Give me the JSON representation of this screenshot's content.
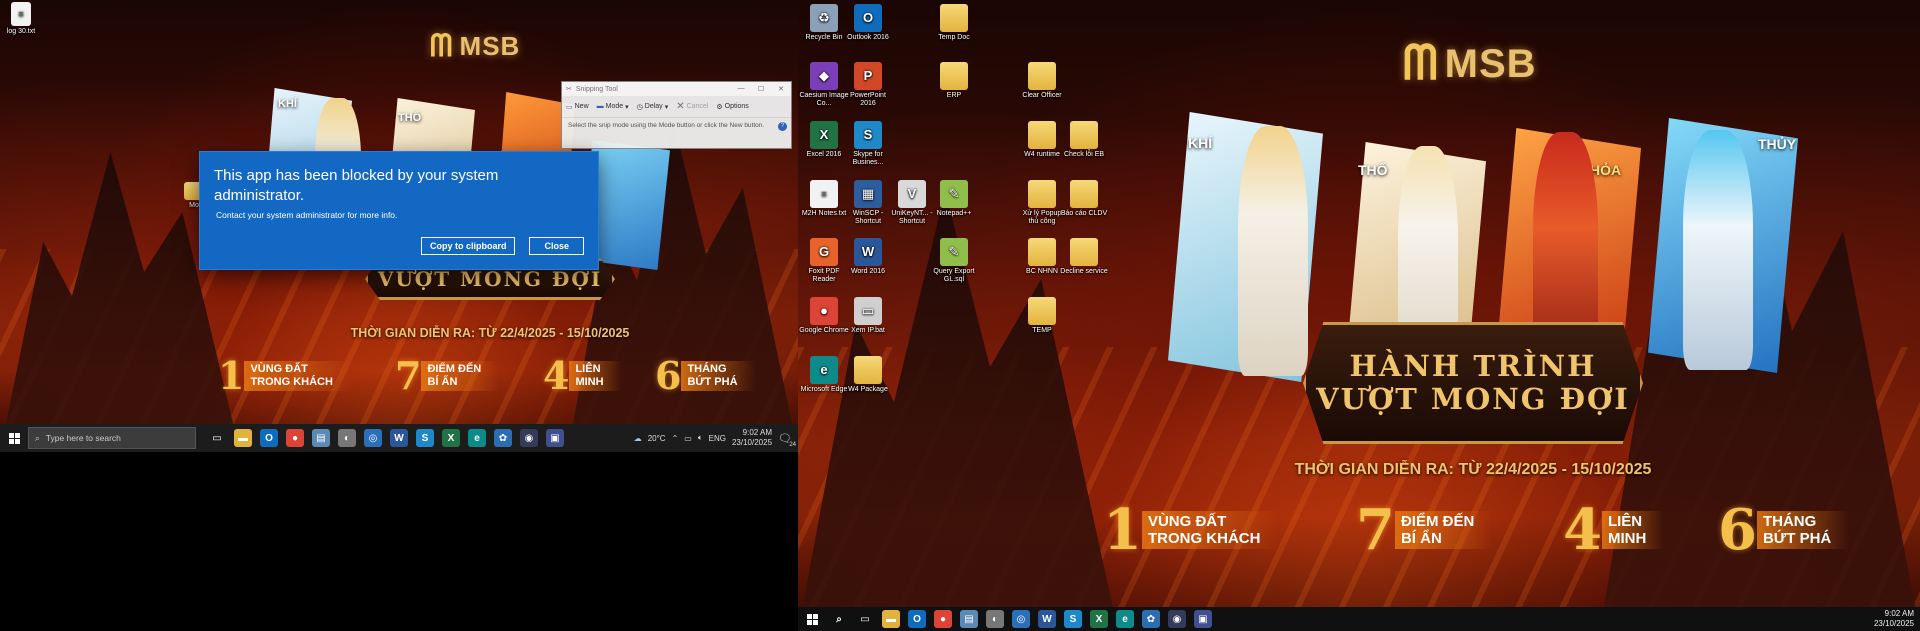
{
  "left_screen": {
    "desktop_file": {
      "label": "log 30.txt",
      "icon": "text-file-icon"
    },
    "partial_label": "Mo",
    "wallpaper": {
      "logo": "MSB",
      "cards": [
        "KHÍ",
        "THỔ"
      ],
      "banner_line2": "VƯỢT MONG ĐỢI",
      "subtitle": "THỜI GIAN DIỄN RA: TỪ 22/4/2025 - 15/10/2025",
      "features": [
        {
          "num": "1",
          "line1": "VÙNG ĐẤT",
          "line2": "TRONG KHÁCH"
        },
        {
          "num": "7",
          "line1": "ĐIỂM ĐẾN",
          "line2": "BÍ ẨN"
        },
        {
          "num": "4",
          "line1": "LIÊN",
          "line2": "MINH"
        },
        {
          "num": "6",
          "line1": "THÁNG",
          "line2": "BỨT PHÁ"
        }
      ]
    },
    "dialog": {
      "title": "This app has been blocked by your system administrator.",
      "message": "Contact your system administrator for more info.",
      "copy_label": "Copy to clipboard",
      "close_label": "Close"
    },
    "snipping_tool": {
      "title": "Snipping Tool",
      "new_label": "New",
      "mode_label": "Mode",
      "delay_label": "Delay",
      "cancel_label": "Cancel",
      "options_label": "Options",
      "hint": "Select the snip mode using the Mode button or click the New button."
    },
    "taskbar": {
      "search_placeholder": "Type here to search",
      "weather": "20°C",
      "lang": "ENG",
      "time": "9:02 AM",
      "date": "23/10/2025",
      "notification_count": "24",
      "apps": [
        {
          "name": "task-view-icon",
          "label": "▭",
          "color": "#1c1c1c"
        },
        {
          "name": "file-explorer-icon",
          "label": "▬",
          "color": "#e2b33c"
        },
        {
          "name": "outlook-icon",
          "label": "O",
          "color": "#0f6cbd"
        },
        {
          "name": "chrome-icon",
          "label": "●",
          "color": "#db4437"
        },
        {
          "name": "app-icon",
          "label": "▤",
          "color": "#5b8ab5"
        },
        {
          "name": "app-icon",
          "label": "◐",
          "color": "#777"
        },
        {
          "name": "app-icon",
          "label": "◎",
          "color": "#2a6fb8"
        },
        {
          "name": "word-icon",
          "label": "W",
          "color": "#2b579a"
        },
        {
          "name": "app-icon",
          "label": "S",
          "color": "#1e88c9"
        },
        {
          "name": "excel-icon",
          "label": "X",
          "color": "#217346"
        },
        {
          "name": "edge-icon",
          "label": "e",
          "color": "#0d8a8a"
        },
        {
          "name": "app-icon",
          "label": "✿",
          "color": "#2b6db3"
        },
        {
          "name": "app-icon",
          "label": "◉",
          "color": "#333a5a"
        },
        {
          "name": "app-icon",
          "label": "▣",
          "color": "#3f4f8f"
        }
      ]
    }
  },
  "right_screen": {
    "wallpaper": {
      "logo": "MSB",
      "cards": [
        "KHÍ",
        "THỔ",
        "HỎA",
        "THỦY"
      ],
      "banner_line1": "HÀNH TRÌNH",
      "banner_line2": "VƯỢT MONG ĐỢI",
      "subtitle": "THỜI GIAN DIỄN RA: TỪ 22/4/2025 - 15/10/2025",
      "features": [
        {
          "num": "1",
          "line1": "VÙNG ĐẤT",
          "line2": "TRONG KHÁCH"
        },
        {
          "num": "7",
          "line1": "ĐIỂM ĐẾN",
          "line2": "BÍ ẨN"
        },
        {
          "num": "4",
          "line1": "LIÊN",
          "line2": "MINH"
        },
        {
          "num": "6",
          "line1": "THÁNG",
          "line2": "BỨT PHÁ"
        }
      ]
    },
    "desktop_icons": [
      {
        "label": "Recycle Bin",
        "icon": "recycle-bin-icon",
        "glyph": "♻",
        "color": "#8aa0b8"
      },
      {
        "label": "Outlook 2016",
        "icon": "outlook-icon",
        "glyph": "O",
        "color": "#0f6cbd"
      },
      {
        "label": "Temp Doc",
        "icon": "folder-icon",
        "glyph": "",
        "color": "folder"
      },
      {
        "label": "Caesium Image Co...",
        "icon": "caesium-icon",
        "glyph": "◆",
        "color": "#7a3fb8"
      },
      {
        "label": "PowerPoint 2016",
        "icon": "powerpoint-icon",
        "glyph": "P",
        "color": "#d24726"
      },
      {
        "label": "ERP",
        "icon": "folder-icon",
        "glyph": "",
        "color": "folder"
      },
      {
        "label": "Clear Officer",
        "icon": "folder-icon",
        "glyph": "",
        "color": "folder"
      },
      {
        "label": "Excel 2016",
        "icon": "excel-icon",
        "glyph": "X",
        "color": "#217346"
      },
      {
        "label": "Skype for Busines...",
        "icon": "skype-icon",
        "glyph": "S",
        "color": "#1e88c9"
      },
      {
        "label": "W4 runtime",
        "icon": "folder-icon",
        "glyph": "",
        "color": "folder"
      },
      {
        "label": "Check lỗi EB",
        "icon": "folder-icon",
        "glyph": "",
        "color": "folder"
      },
      {
        "label": "M2H Notes.txt",
        "icon": "text-file-icon",
        "glyph": "≡",
        "color": "file"
      },
      {
        "label": "WinSCP - Shortcut",
        "icon": "winscp-icon",
        "glyph": "▦",
        "color": "#2c5d9e"
      },
      {
        "label": "UniKeyNT... - Shortcut",
        "icon": "unikey-icon",
        "glyph": "V",
        "color": "#d9d9d9"
      },
      {
        "label": "Notepad++",
        "icon": "notepad-plus-icon",
        "glyph": "✎",
        "color": "#8fbf4a"
      },
      {
        "label": "Xử lý Popup thủ công",
        "icon": "folder-icon",
        "glyph": "",
        "color": "folder"
      },
      {
        "label": "Báo cáo CLDV",
        "icon": "folder-icon",
        "glyph": "",
        "color": "folder"
      },
      {
        "label": "Foxit PDF Reader",
        "icon": "foxit-icon",
        "glyph": "G",
        "color": "#e8632b"
      },
      {
        "label": "Word 2016",
        "icon": "word-icon",
        "glyph": "W",
        "color": "#2b579a"
      },
      {
        "label": "Query Export GL.sql",
        "icon": "sql-file-icon",
        "glyph": "✎",
        "color": "#8fbf4a"
      },
      {
        "label": "BC NHNN",
        "icon": "folder-icon",
        "glyph": "",
        "color": "folder"
      },
      {
        "label": "Decline service",
        "icon": "folder-icon",
        "glyph": "",
        "color": "folder"
      },
      {
        "label": "Google Chrome",
        "icon": "chrome-icon",
        "glyph": "●",
        "color": "#db4437"
      },
      {
        "label": "Xem IP.bat",
        "icon": "bat-file-icon",
        "glyph": "▭",
        "color": "#cfcfcf"
      },
      {
        "label": "TEMP",
        "icon": "folder-icon",
        "glyph": "",
        "color": "folder"
      },
      {
        "label": "Microsoft Edge",
        "icon": "edge-icon",
        "glyph": "e",
        "color": "#0d8a8a"
      },
      {
        "label": "W4 Package",
        "icon": "folder-icon",
        "glyph": "",
        "color": "folder"
      }
    ],
    "taskbar": {
      "time": "9:02 AM",
      "date": "23/10/2025",
      "apps": [
        {
          "name": "search-icon",
          "label": "⌕",
          "color": "#101010"
        },
        {
          "name": "task-view-icon",
          "label": "▭",
          "color": "#101010"
        },
        {
          "name": "file-explorer-icon",
          "label": "▬",
          "color": "#e2b33c"
        },
        {
          "name": "outlook-icon",
          "label": "O",
          "color": "#0f6cbd"
        },
        {
          "name": "chrome-icon",
          "label": "●",
          "color": "#db4437"
        },
        {
          "name": "app-icon",
          "label": "▤",
          "color": "#5b8ab5"
        },
        {
          "name": "app-icon",
          "label": "◐",
          "color": "#777"
        },
        {
          "name": "app-icon",
          "label": "◎",
          "color": "#2a6fb8"
        },
        {
          "name": "word-icon",
          "label": "W",
          "color": "#2b579a"
        },
        {
          "name": "skype-icon",
          "label": "S",
          "color": "#1e88c9"
        },
        {
          "name": "excel-icon",
          "label": "X",
          "color": "#217346"
        },
        {
          "name": "edge-icon",
          "label": "e",
          "color": "#0d8a8a"
        },
        {
          "name": "app-icon",
          "label": "✿",
          "color": "#2b6db3"
        },
        {
          "name": "app-icon",
          "label": "◉",
          "color": "#333a5a"
        },
        {
          "name": "app-icon",
          "label": "▣",
          "color": "#3f4f8f"
        }
      ]
    }
  }
}
